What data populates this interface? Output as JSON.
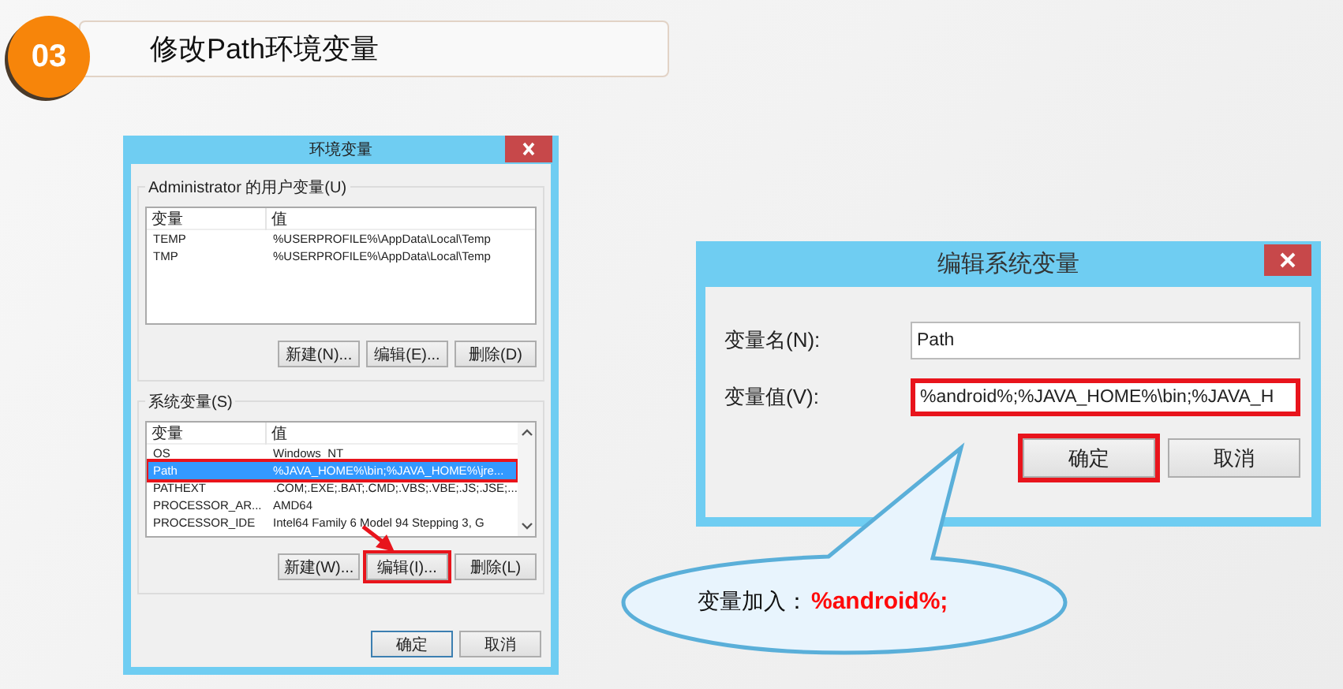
{
  "header": {
    "number": "03",
    "title": "修改Path环境变量"
  },
  "env_dialog": {
    "title": "环境变量",
    "groups": [
      {
        "label": "Administrator 的用户变量(U)",
        "columns": [
          "变量",
          "值"
        ],
        "scrollbar": false,
        "rows": [
          {
            "name": "TEMP",
            "value": "%USERPROFILE%\\AppData\\Local\\Temp",
            "selected": false,
            "highlighted": false
          },
          {
            "name": "TMP",
            "value": "%USERPROFILE%\\AppData\\Local\\Temp",
            "selected": false,
            "highlighted": false
          }
        ],
        "buttons": [
          {
            "label": "新建(N)...",
            "highlighted": false
          },
          {
            "label": "编辑(E)...",
            "highlighted": false
          },
          {
            "label": "删除(D)",
            "highlighted": false
          }
        ]
      },
      {
        "label": "系统变量(S)",
        "columns": [
          "变量",
          "值"
        ],
        "scrollbar": true,
        "rows": [
          {
            "name": "OS",
            "value": "Windows_NT",
            "selected": false,
            "highlighted": false
          },
          {
            "name": "Path",
            "value": "%JAVA_HOME%\\bin;%JAVA_HOME%\\jre...",
            "selected": true,
            "highlighted": true
          },
          {
            "name": "PATHEXT",
            "value": ".COM;.EXE;.BAT;.CMD;.VBS;.VBE;.JS;.JSE;...",
            "selected": false,
            "highlighted": false
          },
          {
            "name": "PROCESSOR_AR...",
            "value": "AMD64",
            "selected": false,
            "highlighted": false
          },
          {
            "name": "PROCESSOR_IDE",
            "value": "Intel64 Family 6 Model 94 Stepping 3, G",
            "selected": false,
            "highlighted": false
          }
        ],
        "buttons": [
          {
            "label": "新建(W)...",
            "highlighted": false
          },
          {
            "label": "编辑(I)...",
            "highlighted": true
          },
          {
            "label": "删除(L)",
            "highlighted": false
          }
        ]
      }
    ],
    "buttons": [
      {
        "label": "确定",
        "default": true
      },
      {
        "label": "取消",
        "default": false
      }
    ]
  },
  "edit_dialog": {
    "title": "编辑系统变量",
    "fields": [
      {
        "label": "变量名(N):",
        "value": "Path",
        "highlighted": false
      },
      {
        "label": "变量值(V):",
        "value": "%android%;%JAVA_HOME%\\bin;%JAVA_H",
        "highlighted": true
      }
    ],
    "buttons": [
      {
        "label": "确定",
        "highlighted": true
      },
      {
        "label": "取消",
        "highlighted": false
      }
    ]
  },
  "callout": {
    "label": "变量加入：",
    "value": "%android%;"
  }
}
